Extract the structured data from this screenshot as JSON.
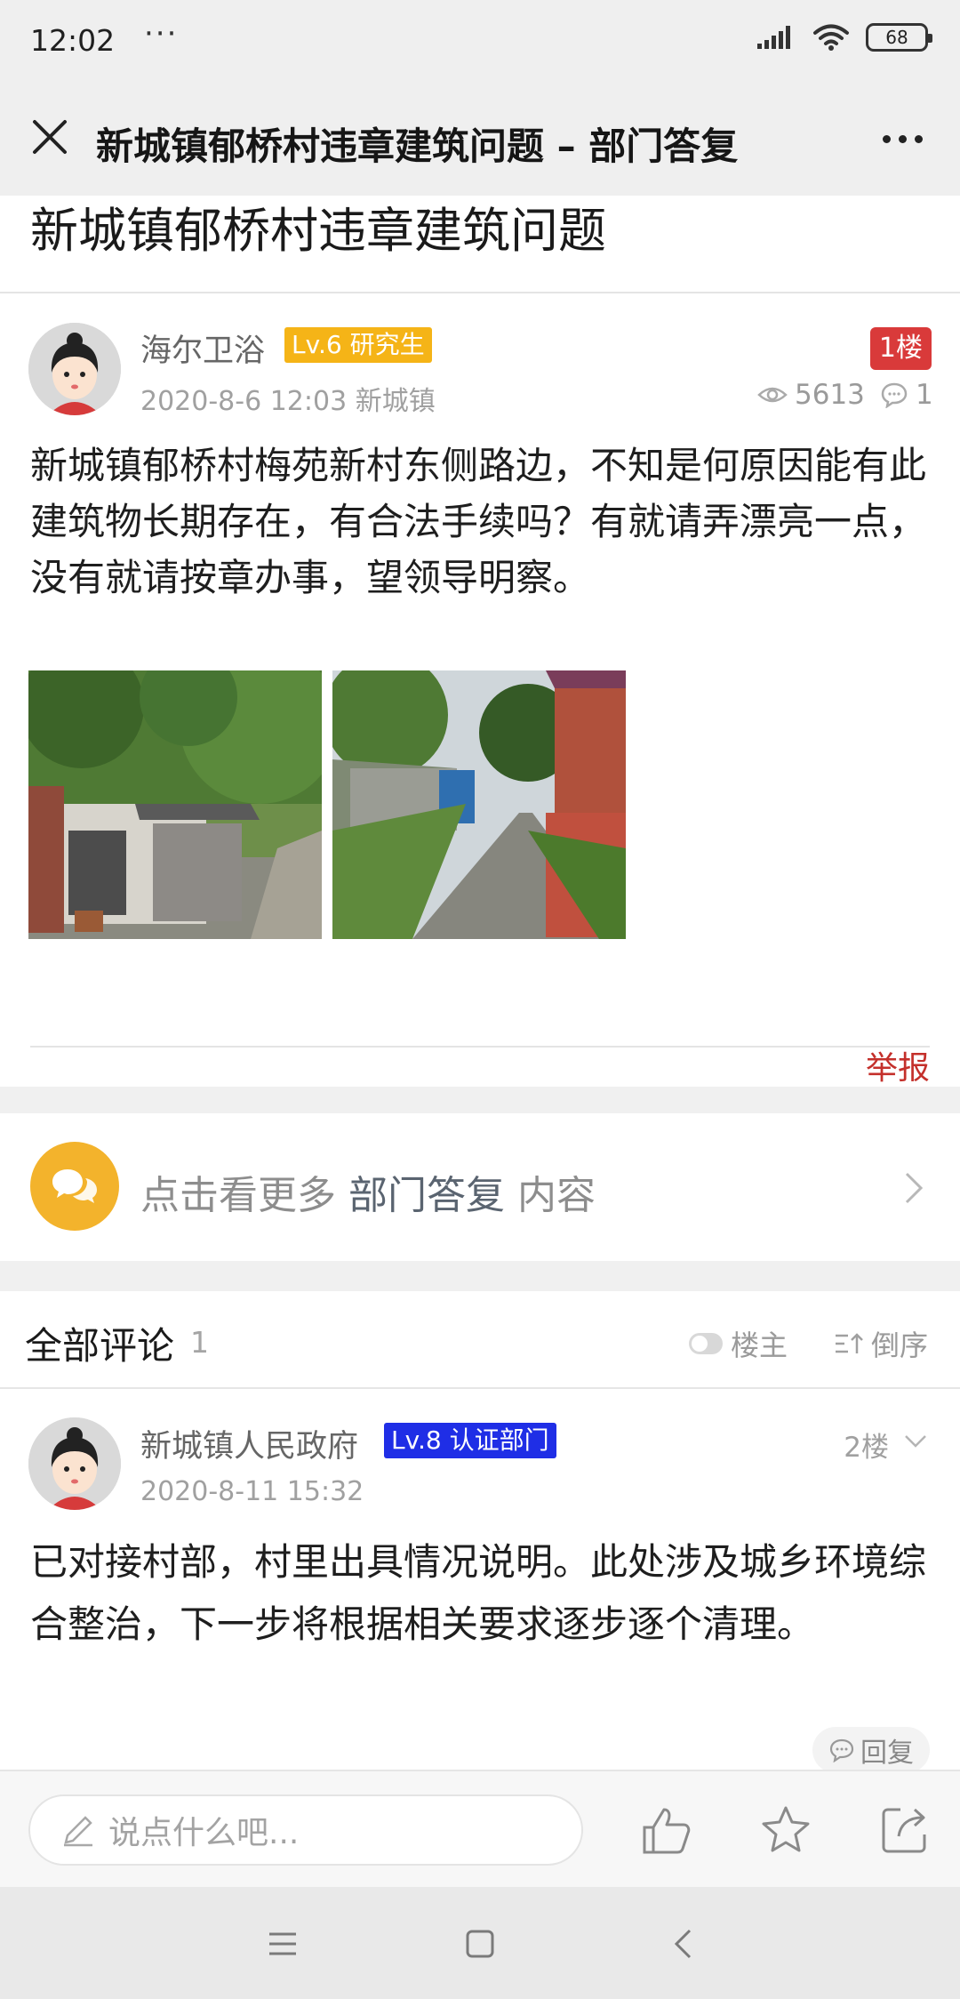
{
  "status_bar": {
    "time": "12:02",
    "dots": "···",
    "battery": "68",
    "icons": [
      "signal-icon",
      "wifi-icon",
      "battery-icon"
    ]
  },
  "title_bar": {
    "title": "新城镇郁桥村违章建筑问题 – 部门答复"
  },
  "post": {
    "title": "新城镇郁桥村违章建筑问题",
    "author": "海尔卫浴",
    "level": "Lv.6 研究生",
    "level_color": "#f5b417",
    "floor": "1楼",
    "date": "2020-8-6 12:03",
    "location": "新城镇",
    "views": "5613",
    "comments": "1",
    "body": "新城镇郁桥村梅苑新村东侧路边，不知是何原因能有此建筑物长期存在，有合法手续吗？有就请弄漂亮一点，没有就请按章办事，望领导明察。",
    "report": "举报"
  },
  "more_link": {
    "prefix": "点击看更多",
    "highlight": "部门答复",
    "suffix": "内容"
  },
  "comments": {
    "title": "全部评论",
    "count": "1",
    "filter_owner": "楼主",
    "filter_reverse": "倒序",
    "items": [
      {
        "author": "新城镇人民政府",
        "level": "Lv.8 认证部门",
        "level_color": "#1f2ee6",
        "floor": "2楼",
        "date": "2020-8-11 15:32",
        "body": "已对接村部，村里出具情况说明。此处涉及城乡环境综合整治，下一步将根据相关要求逐步逐个清理。",
        "reply": "回复"
      }
    ]
  },
  "bottom_bar": {
    "placeholder": "说点什么吧..."
  }
}
